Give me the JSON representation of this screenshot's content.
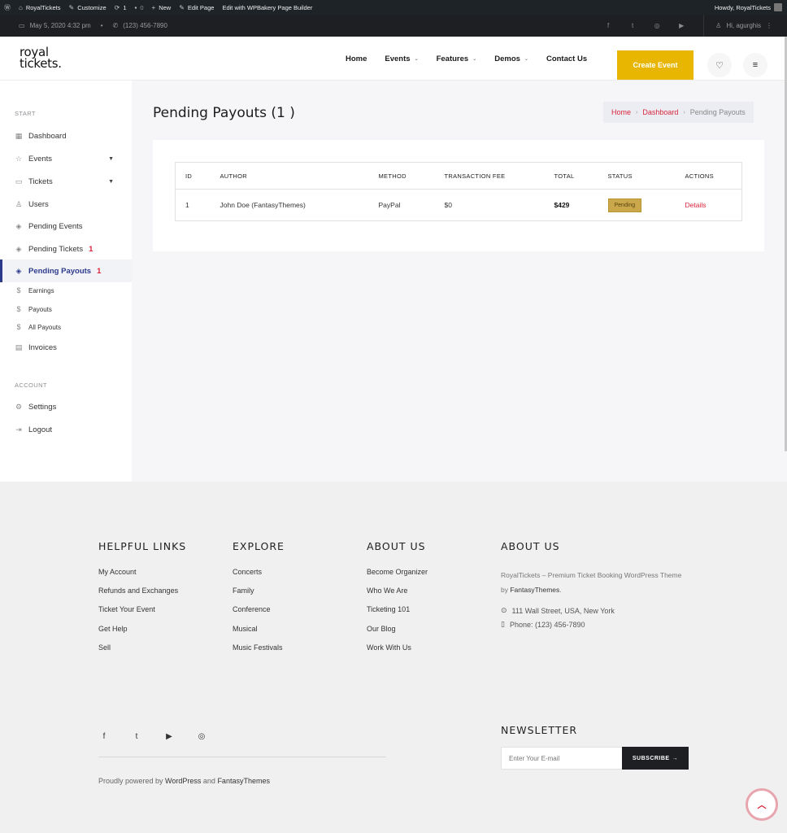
{
  "adminbar": {
    "site_name": "RoyalTickets",
    "customize": "Customize",
    "updates_count": "1",
    "comments_count": "0",
    "new": "New",
    "edit_page": "Edit Page",
    "wpbakery": "Edit with WPBakery Page Builder",
    "howdy": "Howdy, RoyalTickets"
  },
  "topbar": {
    "date": "May 5, 2020 4:32 pm",
    "phone": "(123) 456-7890",
    "user_greeting": "Hi, agurghis"
  },
  "header": {
    "logo_line1": "royal",
    "logo_line2": "tickets.",
    "nav": [
      "Home",
      "Events",
      "Features",
      "Demos",
      "Contact Us"
    ],
    "create_event": "Create Event"
  },
  "sidebar": {
    "section_start": "START",
    "section_account": "ACCOUNT",
    "items": [
      {
        "label": "Dashboard"
      },
      {
        "label": "Events"
      },
      {
        "label": "Tickets"
      },
      {
        "label": "Users"
      },
      {
        "label": "Pending Events"
      },
      {
        "label": "Pending Tickets",
        "count": "1"
      },
      {
        "label": "Pending Payouts",
        "count": "1"
      },
      {
        "label": "Earnings"
      },
      {
        "label": "Payouts"
      },
      {
        "label": "All Payouts"
      },
      {
        "label": "Invoices"
      },
      {
        "label": "Settings"
      },
      {
        "label": "Logout"
      }
    ]
  },
  "main": {
    "title": "Pending Payouts (1 )",
    "breadcrumb": [
      "Home",
      "Dashboard",
      "Pending Payouts"
    ],
    "table": {
      "headers": [
        "ID",
        "AUTHOR",
        "METHOD",
        "TRANSACTION FEE",
        "TOTAL",
        "STATUS",
        "ACTIONS"
      ],
      "rows": [
        {
          "id": "1",
          "author": "John Doe (FantasyThemes)",
          "method": "PayPal",
          "fee": "$0",
          "total": "$429",
          "status": "Pending",
          "action": "Details"
        }
      ]
    }
  },
  "footer": {
    "helpful": {
      "title": "HELPFUL LINKS",
      "links": [
        "My Account",
        "Refunds and Exchanges",
        "Ticket Your Event",
        "Get Help",
        "Sell"
      ]
    },
    "explore": {
      "title": "EXPLORE",
      "links": [
        "Concerts",
        "Family",
        "Conference",
        "Musical",
        "Music Festivals"
      ]
    },
    "about_links": {
      "title": "ABOUT US",
      "links": [
        "Become Organizer",
        "Who We Are",
        "Ticketing 101",
        "Our Blog",
        "Work With Us"
      ]
    },
    "about": {
      "title": "ABOUT US",
      "text_prefix": "RoyalTickets – Premium Ticket Booking WordPress Theme by ",
      "text_brand": "FantasyThemes",
      "text_suffix": ".",
      "address": "111 Wall Street, USA, New York",
      "phone": "Phone: (123) 456-7890"
    },
    "newsletter_title": "NEWSLETTER",
    "newsletter_placeholder": "Enter Your E-mail",
    "subscribe": "SUBSCRIBE",
    "powered_prefix": "Proudly powered by ",
    "powered_wp": "WordPress",
    "powered_and": " and ",
    "powered_ft": "FantasyThemes"
  }
}
